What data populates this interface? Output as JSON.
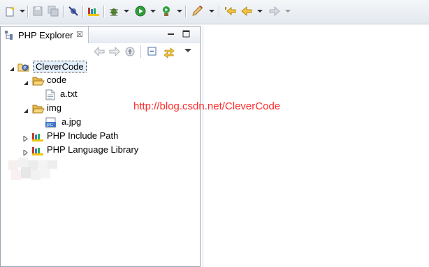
{
  "toolbar": {
    "icons": [
      "new-wizard-icon",
      "save-icon",
      "save-all-icon",
      "skip-breakpoints-icon",
      "php-library-icon",
      "debug-icon",
      "run-icon",
      "external-tools-icon",
      "edit-tool-icon",
      "last-edit-location-icon",
      "back-icon",
      "forward-icon"
    ]
  },
  "explorer": {
    "tab_title": "PHP Explorer",
    "close_glyph": "☒",
    "tree": [
      {
        "label": "CleverCode",
        "level": 0,
        "expanded": true,
        "icon": "php-project-icon",
        "selected": true
      },
      {
        "label": "code",
        "level": 1,
        "expanded": true,
        "icon": "open-folder-icon"
      },
      {
        "label": "a.txt",
        "level": 2,
        "icon": "text-file-icon"
      },
      {
        "label": "img",
        "level": 1,
        "expanded": true,
        "icon": "open-folder-icon"
      },
      {
        "label": "a.jpg",
        "level": 2,
        "icon": "jpg-file-icon"
      },
      {
        "label": "PHP Include Path",
        "level": 1,
        "expanded": false,
        "icon": "library-icon"
      },
      {
        "label": "PHP Language Library",
        "level": 1,
        "expanded": false,
        "icon": "library-icon"
      }
    ]
  },
  "editor": {
    "watermark": "http://blog.csdn.net/CleverCode"
  },
  "colors": {
    "watermark": "#ff2a2a",
    "selection_bg": "#e3effd",
    "toolbar_bg": "#e3e8ef"
  }
}
